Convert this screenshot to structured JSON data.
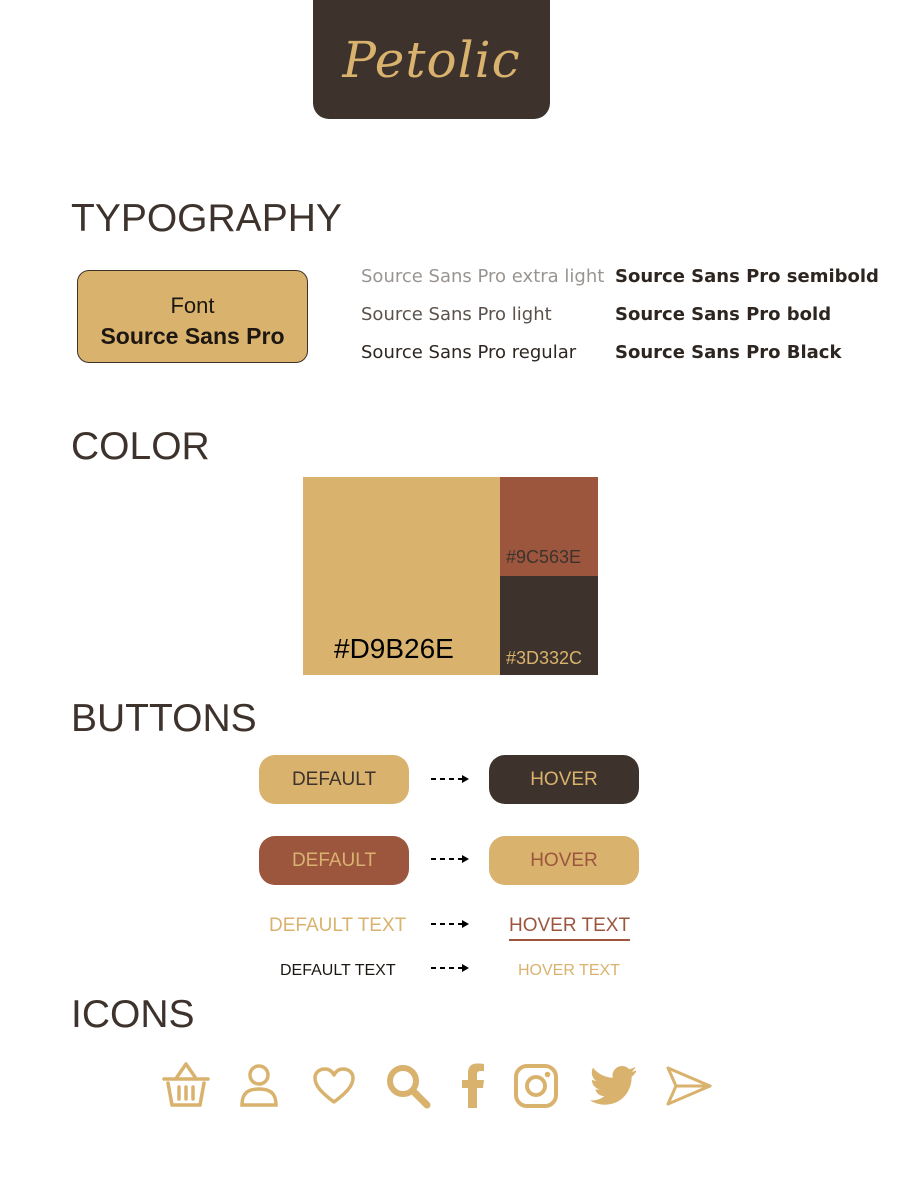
{
  "brand": {
    "logo_text": "Petolic"
  },
  "sections": {
    "typography": "TYPOGRAPHY",
    "color": "COLOR",
    "buttons": "BUTTONS",
    "icons": "ICONS"
  },
  "typography": {
    "card_label": "Font",
    "card_font": "Source Sans Pro",
    "weights_left": [
      "Source Sans Pro extra light",
      "Source Sans Pro light",
      "Source Sans Pro regular"
    ],
    "weights_right": [
      "Source Sans Pro semibold",
      "Source Sans Pro bold",
      "Source Sans Pro Black"
    ]
  },
  "colors": {
    "primary": {
      "hex": "#D9B26E",
      "label": "#D9B26E"
    },
    "secondary": {
      "hex": "#9C563E",
      "label": "#9C563E"
    },
    "dark": {
      "hex": "#3D332C",
      "label": "#3D332C"
    }
  },
  "buttons": {
    "row1": {
      "default": "DEFAULT",
      "hover": "HOVER"
    },
    "row2": {
      "default": "DEFAULT",
      "hover": "HOVER"
    },
    "text_row1": {
      "default": "DEFAULT TEXT",
      "hover": "HOVER TEXT"
    },
    "text_row2": {
      "default": "DEFAULT TEXT",
      "hover": "HOVER TEXT"
    }
  },
  "icons": [
    "basket-icon",
    "user-icon",
    "heart-icon",
    "search-icon",
    "facebook-icon",
    "instagram-icon",
    "twitter-icon",
    "send-icon"
  ]
}
